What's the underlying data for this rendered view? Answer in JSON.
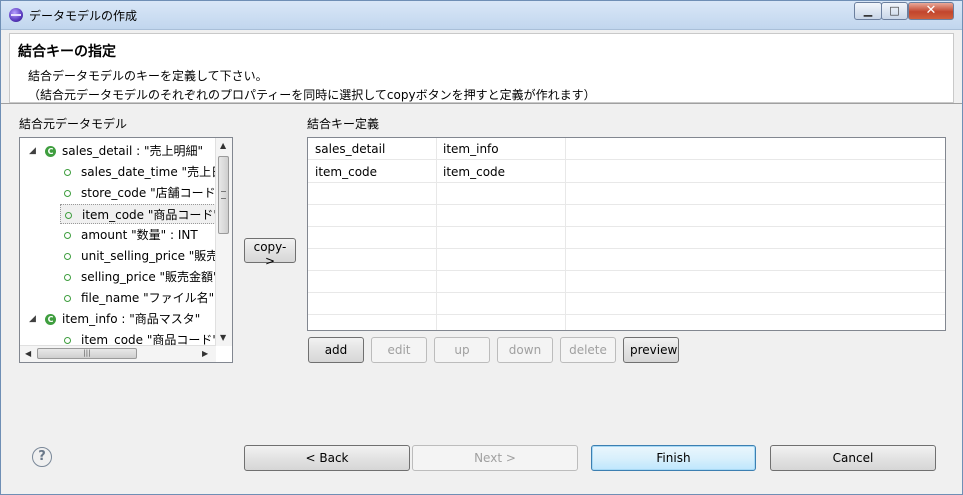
{
  "window": {
    "title": "データモデルの作成",
    "min_icon": "minimize-icon",
    "max_icon": "maximize-icon",
    "close_icon": "close-icon",
    "min_glyph": "▁",
    "max_glyph": "□",
    "close_glyph": "✕"
  },
  "banner": {
    "title": "結合キーの指定",
    "line1": "結合データモデルのキーを定義して下さい。",
    "line2": "（結合元データモデルのそれぞれのプロパティーを同時に選択してcopyボタンを押すと定義が作れます）"
  },
  "left": {
    "label": "結合元データモデル",
    "tree": [
      {
        "level": 0,
        "expanded": true,
        "text": "sales_detail : \"売上明細\""
      },
      {
        "level": 1,
        "text": "sales_date_time \"売上日時\""
      },
      {
        "level": 1,
        "text": "store_code \"店舗コード\""
      },
      {
        "level": 1,
        "text": "item_code \"商品コード\"",
        "selected": true
      },
      {
        "level": 1,
        "text": "amount \"数量\" : INT"
      },
      {
        "level": 1,
        "text": "unit_selling_price \"販売単価\""
      },
      {
        "level": 1,
        "text": "selling_price \"販売金額\""
      },
      {
        "level": 1,
        "text": "file_name \"ファイル名\""
      },
      {
        "level": 0,
        "expanded": true,
        "text": "item_info : \"商品マスタ\""
      },
      {
        "level": 1,
        "text": "item_code \"商品コード\""
      }
    ]
  },
  "copy_button": "copy->",
  "right": {
    "label": "結合キー定義",
    "columns": [
      "sales_detail",
      "item_info"
    ],
    "rows": [
      [
        "item_code",
        "item_code"
      ]
    ]
  },
  "table_buttons": {
    "add": "add",
    "edit": "edit",
    "up": "up",
    "down": "down",
    "delete": "delete",
    "preview": "preview"
  },
  "footer": {
    "back": "< Back",
    "next": "Next >",
    "finish": "Finish",
    "cancel": "Cancel",
    "help_glyph": "?"
  },
  "colors": {
    "accent": "#3c7fb1",
    "tree_icon": "#3f9e3f"
  }
}
